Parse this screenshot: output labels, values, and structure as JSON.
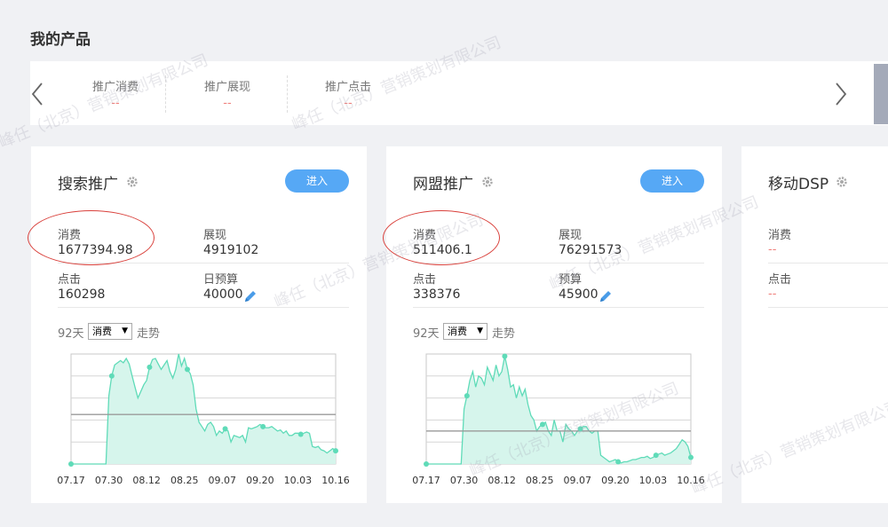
{
  "page_title": "我的产品",
  "summary": {
    "metrics": [
      {
        "label": "推广消费",
        "value": "--"
      },
      {
        "label": "推广展现",
        "value": "--"
      },
      {
        "label": "推广点击",
        "value": "--"
      }
    ]
  },
  "cards": [
    {
      "title": "搜索推广",
      "enter_label": "进入",
      "stats": {
        "cost_label": "消费",
        "cost_value": "1677394.98",
        "impr_label": "展现",
        "impr_value": "4919102",
        "click_label": "点击",
        "click_value": "160298",
        "budget_label": "日预算",
        "budget_value": "40000"
      },
      "range": {
        "days": "92天",
        "selected": "消费",
        "trend": "走势"
      }
    },
    {
      "title": "网盟推广",
      "enter_label": "进入",
      "stats": {
        "cost_label": "消费",
        "cost_value": "511406.1",
        "impr_label": "展现",
        "impr_value": "76291573",
        "click_label": "点击",
        "click_value": "338376",
        "budget_label": "预算",
        "budget_value": "45900"
      },
      "range": {
        "days": "92天",
        "selected": "消费",
        "trend": "走势"
      }
    },
    {
      "title": "移动DSP",
      "stats": {
        "cost_label": "消费",
        "cost_value": "--",
        "click_label": "点击",
        "click_value": "--"
      }
    }
  ],
  "watermark_text": "峰任（北京）营销策划有限公司",
  "colors": {
    "accent": "#56a8f5",
    "area_fill": "#d6f5ec",
    "area_line": "#5fdbb8",
    "dash_red": "#f0807c",
    "annotation_circle": "#d9403b"
  },
  "chart_data": [
    {
      "type": "area",
      "series_name": "消费",
      "x_tick_labels": [
        "07.17",
        "07.30",
        "08.12",
        "08.25",
        "09.07",
        "09.20",
        "10.03",
        "10.16"
      ],
      "y": [
        0,
        0,
        0,
        0,
        0,
        0,
        0,
        0,
        0,
        0,
        0,
        0,
        0,
        62,
        80,
        90,
        92,
        94,
        92,
        96,
        91,
        80,
        70,
        60,
        66,
        72,
        76,
        88,
        95,
        96,
        91,
        86,
        90,
        94,
        84,
        78,
        86,
        100,
        89,
        96,
        86,
        82,
        72,
        50,
        38,
        34,
        30,
        36,
        38,
        34,
        26,
        30,
        28,
        32,
        30,
        20,
        26,
        25,
        24,
        26,
        20,
        33,
        32,
        33,
        34,
        36,
        34,
        33,
        33,
        34,
        32,
        30,
        31,
        28,
        30,
        26,
        26,
        28,
        28,
        27,
        28,
        29,
        28,
        16,
        15,
        16,
        13,
        12,
        10,
        12,
        14,
        12
      ],
      "markers": [
        0,
        14,
        27,
        40,
        53,
        66,
        79,
        91
      ],
      "average": 45,
      "grid": true
    },
    {
      "type": "area",
      "series_name": "消费",
      "x_tick_labels": [
        "07.17",
        "07.30",
        "08.12",
        "08.25",
        "09.07",
        "09.20",
        "10.03",
        "10.16"
      ],
      "y": [
        0,
        0,
        0,
        0,
        0,
        0,
        0,
        0,
        0,
        0,
        0,
        0,
        0,
        50,
        62,
        76,
        84,
        70,
        80,
        78,
        72,
        88,
        82,
        76,
        90,
        80,
        84,
        98,
        86,
        70,
        72,
        60,
        70,
        62,
        68,
        54,
        44,
        40,
        30,
        34,
        36,
        38,
        30,
        26,
        40,
        30,
        30,
        20,
        36,
        32,
        30,
        26,
        30,
        32,
        34,
        34,
        30,
        28,
        30,
        30,
        8,
        6,
        4,
        2,
        3,
        4,
        2,
        1,
        2,
        2,
        3,
        4,
        4,
        5,
        6,
        6,
        7,
        5,
        6,
        8,
        9,
        10,
        8,
        9,
        10,
        12,
        14,
        18,
        22,
        20,
        16,
        6
      ],
      "markers": [
        0,
        14,
        27,
        40,
        53,
        66,
        79,
        91
      ],
      "average": 30,
      "grid": true
    }
  ]
}
